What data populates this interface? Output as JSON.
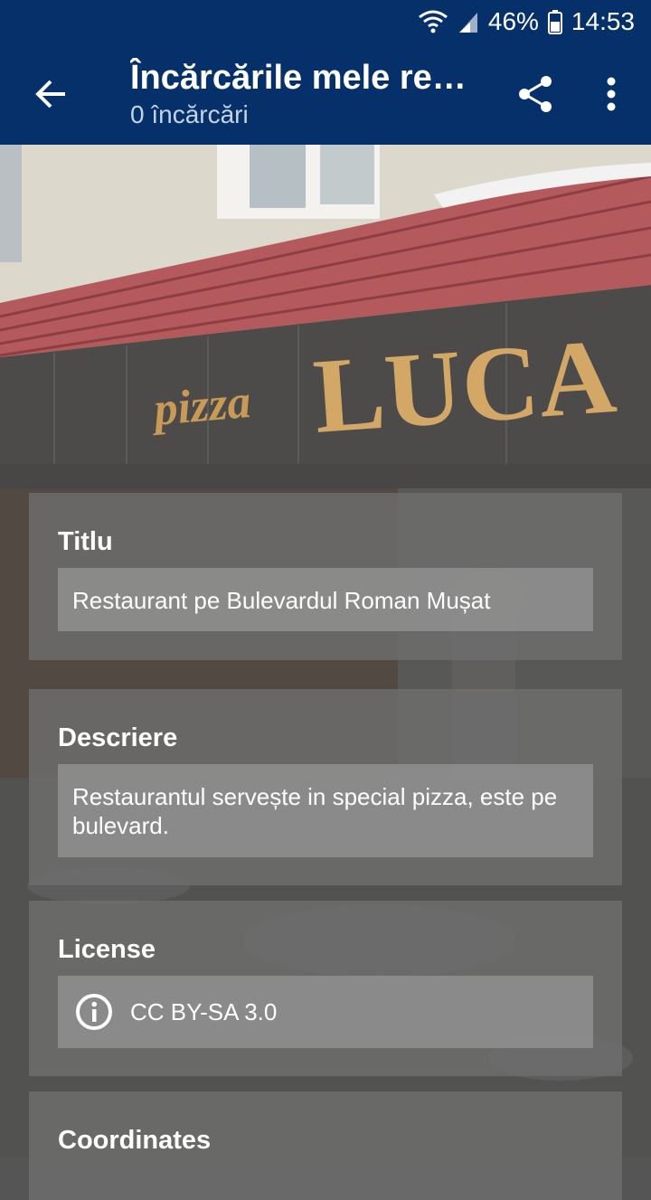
{
  "status_bar": {
    "battery_percent": "46%",
    "time": "14:53",
    "icons": [
      "wifi-icon",
      "signal-icon",
      "battery-icon"
    ]
  },
  "app_bar": {
    "title": "Încărcările mele rec…",
    "subtitle": "0 încărcări",
    "icons": [
      "back-arrow-icon",
      "share-icon",
      "more-vert-icon"
    ]
  },
  "photo": {
    "sign_small": "pizza",
    "sign_big": "LUCA"
  },
  "details": {
    "title_label": "Titlu",
    "title_value": "Restaurant pe Bulevardul Roman Mușat",
    "description_label": "Descriere",
    "description_value": "Restaurantul servește in special pizza, este pe bulevard.",
    "license_label": "License",
    "license_value": "CC BY-SA 3.0",
    "coordinates_label": "Coordinates"
  },
  "colors": {
    "app_bar": "#06306a",
    "text": "#ffffff"
  }
}
